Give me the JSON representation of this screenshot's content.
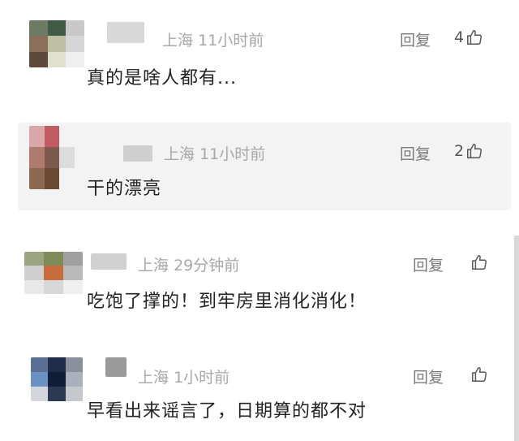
{
  "comments": [
    {
      "location": "上海",
      "time": "11小时前",
      "reply_label": "回复",
      "likes": "4",
      "text": "真的是啥人都有...",
      "avatar_colors": [
        "#6d7a64",
        "#3f5b46",
        "#c8c8c8",
        "#8b6f5a",
        "#bfbfa3",
        "#d6d6d6",
        "#5e4a3d",
        "#e0e0cf",
        "#efefef"
      ],
      "name_color": "#d8d8d8"
    },
    {
      "location": "上海",
      "time": "11小时前",
      "reply_label": "回复",
      "likes": "2",
      "text": "干的漂亮",
      "avatar_colors": [
        "#d9a7a7",
        "#c05a63",
        "#f3f3f3",
        "#b07a6e",
        "#7c5a4d",
        "#dcdcdc",
        "#8c6a52",
        "#6a4a32",
        "#f3f3f3"
      ],
      "name_color": "#cfcfcf"
    },
    {
      "location": "上海",
      "time": "29分钟前",
      "reply_label": "回复",
      "likes": "",
      "text": "吃饱了撑的！到牢房里消化消化！",
      "avatar_colors": [
        "#9aa580",
        "#7f8a59",
        "#a0a0a0",
        "#cfcfcf",
        "#c96c3c",
        "#b9b9b9",
        "#e8e8e8",
        "#d7d7d7",
        "#efefef"
      ],
      "name_color": "#d0d0d0"
    },
    {
      "location": "上海",
      "time": "1小时前",
      "reply_label": "回复",
      "likes": "",
      "text": "早看出来谣言了，日期算的都不对",
      "avatar_colors": [
        "#5a6f93",
        "#1f2d48",
        "#8b8f9c",
        "#6b91c2",
        "#0f1e36",
        "#aab0bc",
        "#d3d7dd",
        "#2b3a52",
        "#c4c7cc"
      ],
      "name_color": "#9a9a9a"
    }
  ]
}
